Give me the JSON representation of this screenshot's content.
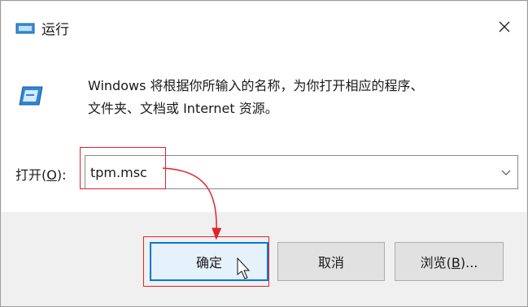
{
  "window": {
    "title": "运行",
    "close_glyph": "✕"
  },
  "dialog": {
    "description_line1": "Windows 将根据你所输入的名称，为你打开相应的程序、",
    "description_line2": "文件夹、文档或 Internet 资源。",
    "open_label_prefix": "打开(",
    "open_label_key": "O",
    "open_label_suffix": "):",
    "input_value": "tpm.msc"
  },
  "buttons": {
    "ok_label": "确定",
    "cancel_label": "取消",
    "browse_prefix": "浏览(",
    "browse_key": "B",
    "browse_suffix": ")..."
  },
  "colors": {
    "annotation_red": "#e1232b",
    "accent_blue": "#0078d7"
  },
  "icons": [
    "run-window-icon",
    "run-program-icon",
    "close-icon",
    "chevron-down-icon",
    "mouse-cursor-icon"
  ]
}
